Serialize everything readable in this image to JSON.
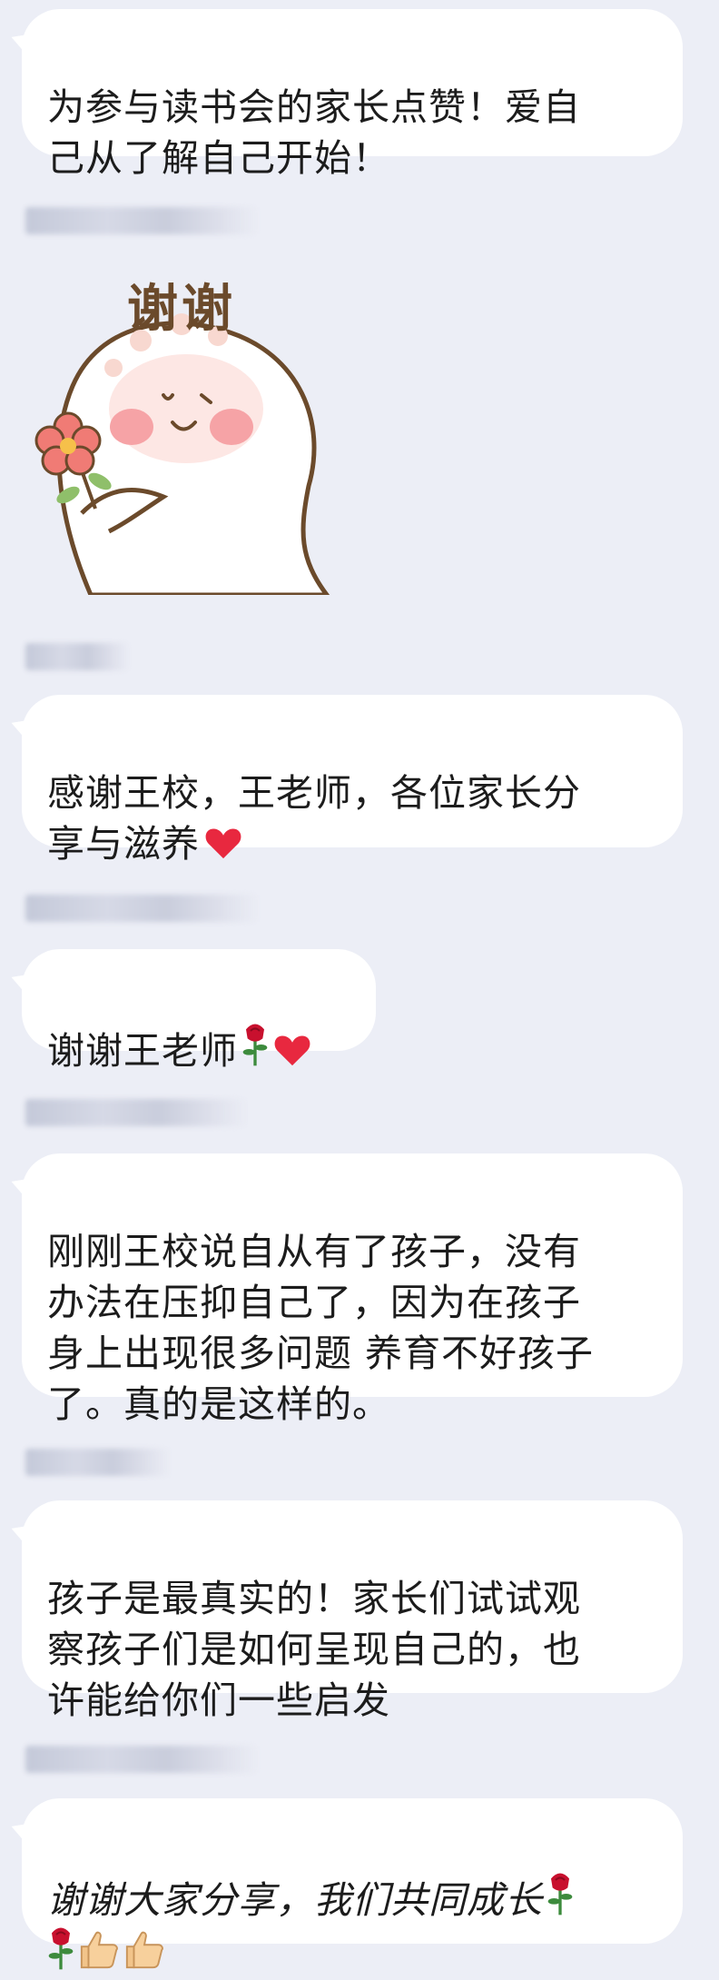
{
  "messages": {
    "m1": {
      "text": "为参与读书会的家长点赞！爱自己从了解自己开始！"
    },
    "sticker": {
      "caption": "谢谢",
      "icon": "thank-you-sticker-icon"
    },
    "m3": {
      "text": "感谢王校，王老师，各位家长分享与滋养",
      "icon": "red-heart-icon"
    },
    "m4": {
      "text": "谢谢王老师",
      "icons": [
        "rose-icon",
        "red-heart-icon"
      ]
    },
    "m5": {
      "text": "刚刚王校说自从有了孩子，没有办法在压抑自己了，因为在孩子身上出现很多问题 养育不好孩子了。真的是这样的。"
    },
    "m6": {
      "text": "孩子是最真实的！家长们试试观察孩子们是如何呈现自己的，也许能给你们一些启发"
    },
    "m7": {
      "text": "谢谢大家分享，我们共同成长",
      "icons": [
        "rose-icon",
        "rose-icon",
        "thumbs-up-icon",
        "thumbs-up-icon"
      ]
    }
  },
  "colors": {
    "background": "#eceef6",
    "bubble": "#ffffff",
    "heart": "#e8283f",
    "rose": "#c8102e"
  }
}
